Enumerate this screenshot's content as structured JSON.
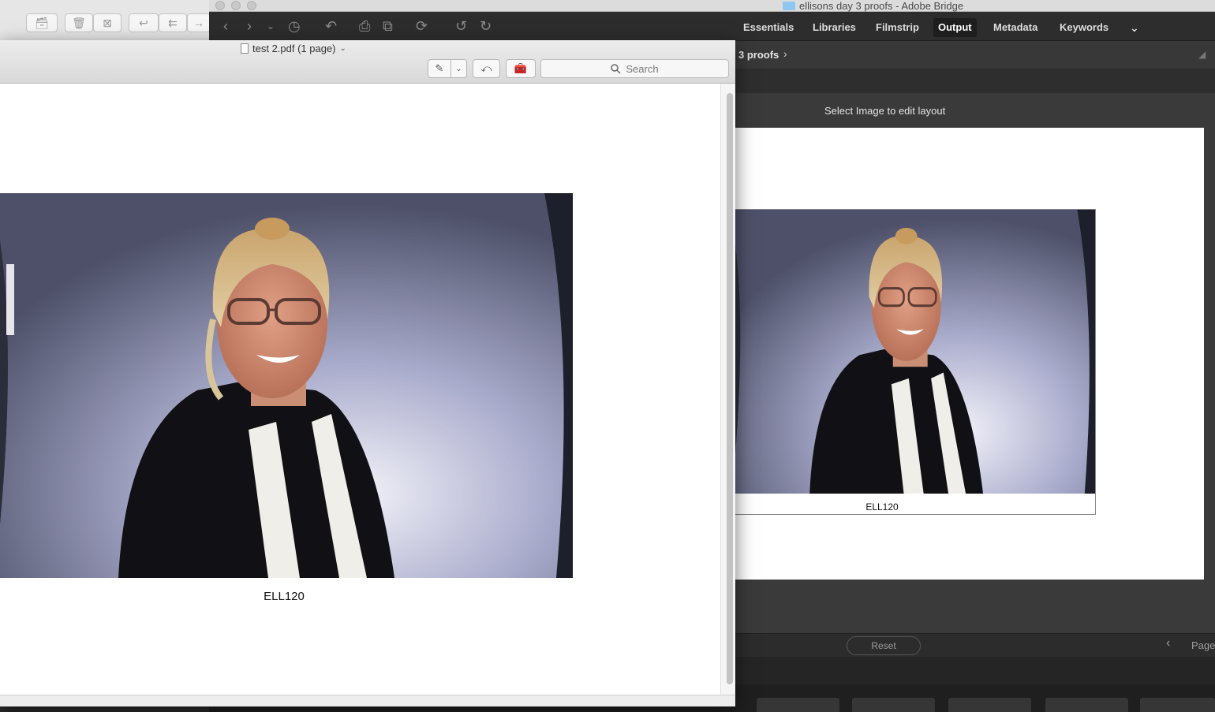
{
  "bridge": {
    "window_title": "ellisons day 3 proofs - Adobe Bridge",
    "workspace_tabs": [
      "Essentials",
      "Libraries",
      "Filmstrip",
      "Output",
      "Metadata",
      "Keywords"
    ],
    "active_tab": "Output",
    "path_label": "3 proofs",
    "layout_message": "Select Image to edit layout",
    "proof_caption": "ELL120",
    "reset_label": "Reset",
    "page_label": "Page"
  },
  "preview": {
    "document_title": "test 2.pdf (1 page)",
    "search_placeholder": "Search",
    "image_caption": "ELL120"
  },
  "colors": {
    "bridge_bg": "#323232",
    "active_tab_bg": "#1e1e1e",
    "backdrop_blue": "#8a8fb7"
  }
}
